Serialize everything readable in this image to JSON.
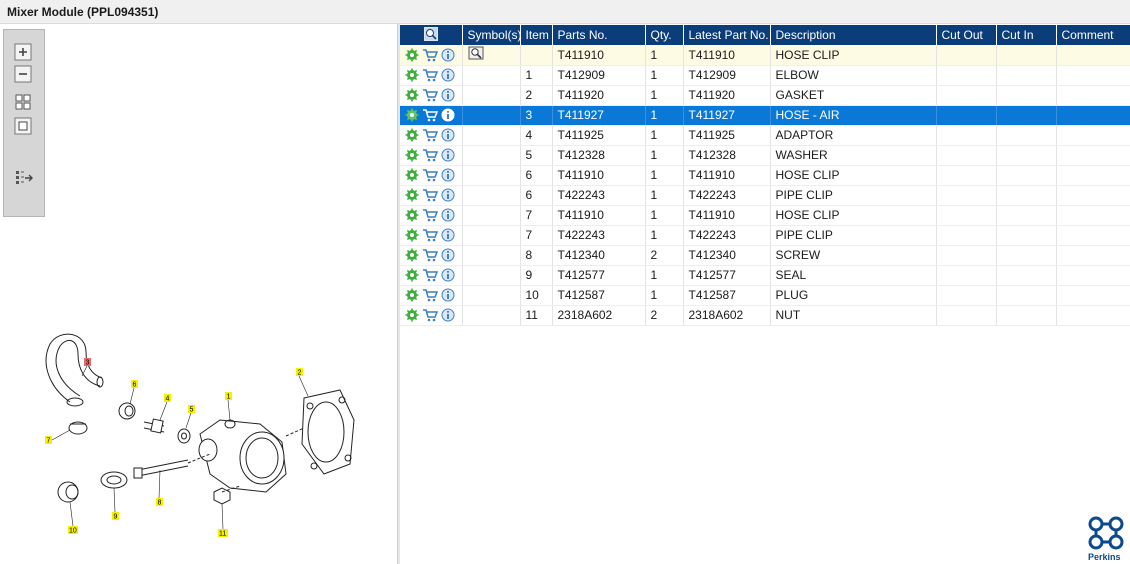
{
  "window": {
    "title": "Mixer Module (PPL094351)"
  },
  "toolbar": {
    "zoom_in": "zoom-in",
    "zoom_out": "zoom-out",
    "fit": "fit-page",
    "reset": "reset-view",
    "export": "export"
  },
  "columns": [
    "",
    "Symbol(s)",
    "Item",
    "Parts No.",
    "Qty.",
    "Latest Part No.",
    "Description",
    "Cut Out",
    "Cut In",
    "Comment"
  ],
  "rows": [
    {
      "item": "",
      "part_no": "T411910",
      "qty": "1",
      "latest": "T411910",
      "desc": "HOSE CLIP",
      "symbol": true,
      "state": "highlight"
    },
    {
      "item": "1",
      "part_no": "T412909",
      "qty": "1",
      "latest": "T412909",
      "desc": "ELBOW",
      "state": ""
    },
    {
      "item": "2",
      "part_no": "T411920",
      "qty": "1",
      "latest": "T411920",
      "desc": "GASKET",
      "state": ""
    },
    {
      "item": "3",
      "part_no": "T411927",
      "qty": "1",
      "latest": "T411927",
      "desc": "HOSE - AIR",
      "state": "selected"
    },
    {
      "item": "4",
      "part_no": "T411925",
      "qty": "1",
      "latest": "T411925",
      "desc": "ADAPTOR",
      "state": ""
    },
    {
      "item": "5",
      "part_no": "T412328",
      "qty": "1",
      "latest": "T412328",
      "desc": "WASHER",
      "state": ""
    },
    {
      "item": "6",
      "part_no": "T411910",
      "qty": "1",
      "latest": "T411910",
      "desc": "HOSE CLIP",
      "state": ""
    },
    {
      "item": "6",
      "part_no": "T422243",
      "qty": "1",
      "latest": "T422243",
      "desc": "PIPE CLIP",
      "state": ""
    },
    {
      "item": "7",
      "part_no": "T411910",
      "qty": "1",
      "latest": "T411910",
      "desc": "HOSE CLIP",
      "state": ""
    },
    {
      "item": "7",
      "part_no": "T422243",
      "qty": "1",
      "latest": "T422243",
      "desc": "PIPE CLIP",
      "state": ""
    },
    {
      "item": "8",
      "part_no": "T412340",
      "qty": "2",
      "latest": "T412340",
      "desc": "SCREW",
      "state": ""
    },
    {
      "item": "9",
      "part_no": "T412577",
      "qty": "1",
      "latest": "T412577",
      "desc": "SEAL",
      "state": ""
    },
    {
      "item": "10",
      "part_no": "T412587",
      "qty": "1",
      "latest": "T412587",
      "desc": "PLUG",
      "state": ""
    },
    {
      "item": "11",
      "part_no": "2318A602",
      "qty": "2",
      "latest": "2318A602",
      "desc": "NUT",
      "state": ""
    }
  ],
  "drawing": {
    "callouts": [
      "3",
      "6",
      "4",
      "5",
      "1",
      "2",
      "7",
      "10",
      "9",
      "8",
      "11"
    ],
    "highlighted_callout": "3"
  },
  "logo": {
    "text": "Perkins"
  },
  "colors": {
    "header_bg": "#0b3d7a",
    "selected_row": "#0a78d7",
    "highlight_row": "#fdfbe3",
    "callout_yellow": "#f5f000",
    "callout_red": "#e86a6a"
  }
}
